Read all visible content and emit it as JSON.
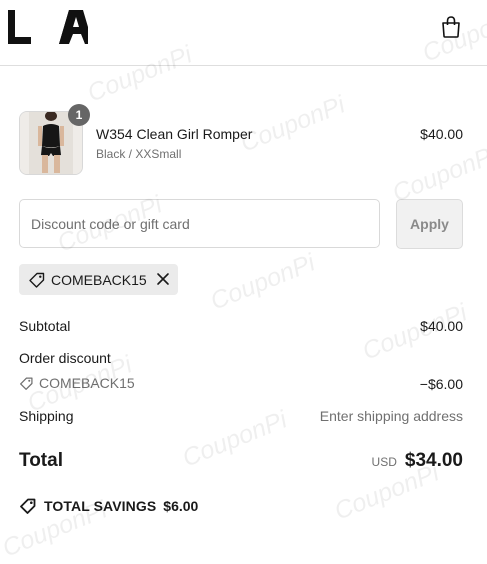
{
  "header": {
    "logo_text": "LA",
    "cart_icon": "shopping-bag-icon"
  },
  "order": {
    "items": [
      {
        "quantity": "1",
        "title": "W354 Clean Girl Romper",
        "variant": "Black / XXSmall",
        "price": "$40.00"
      }
    ]
  },
  "discount": {
    "placeholder": "Discount code or gift card",
    "value": "",
    "apply_label": "Apply",
    "applied_code": "COMEBACK15"
  },
  "summary": {
    "subtotal_label": "Subtotal",
    "subtotal_value": "$40.00",
    "order_discount_label": "Order discount",
    "discount_code": "COMEBACK15",
    "discount_value": "−$6.00",
    "shipping_label": "Shipping",
    "shipping_value": "Enter shipping address",
    "total_label": "Total",
    "currency": "USD",
    "total_value": "$34.00",
    "savings_label": "TOTAL SAVINGS",
    "savings_value": "$6.00"
  },
  "watermark": "CouponPi"
}
